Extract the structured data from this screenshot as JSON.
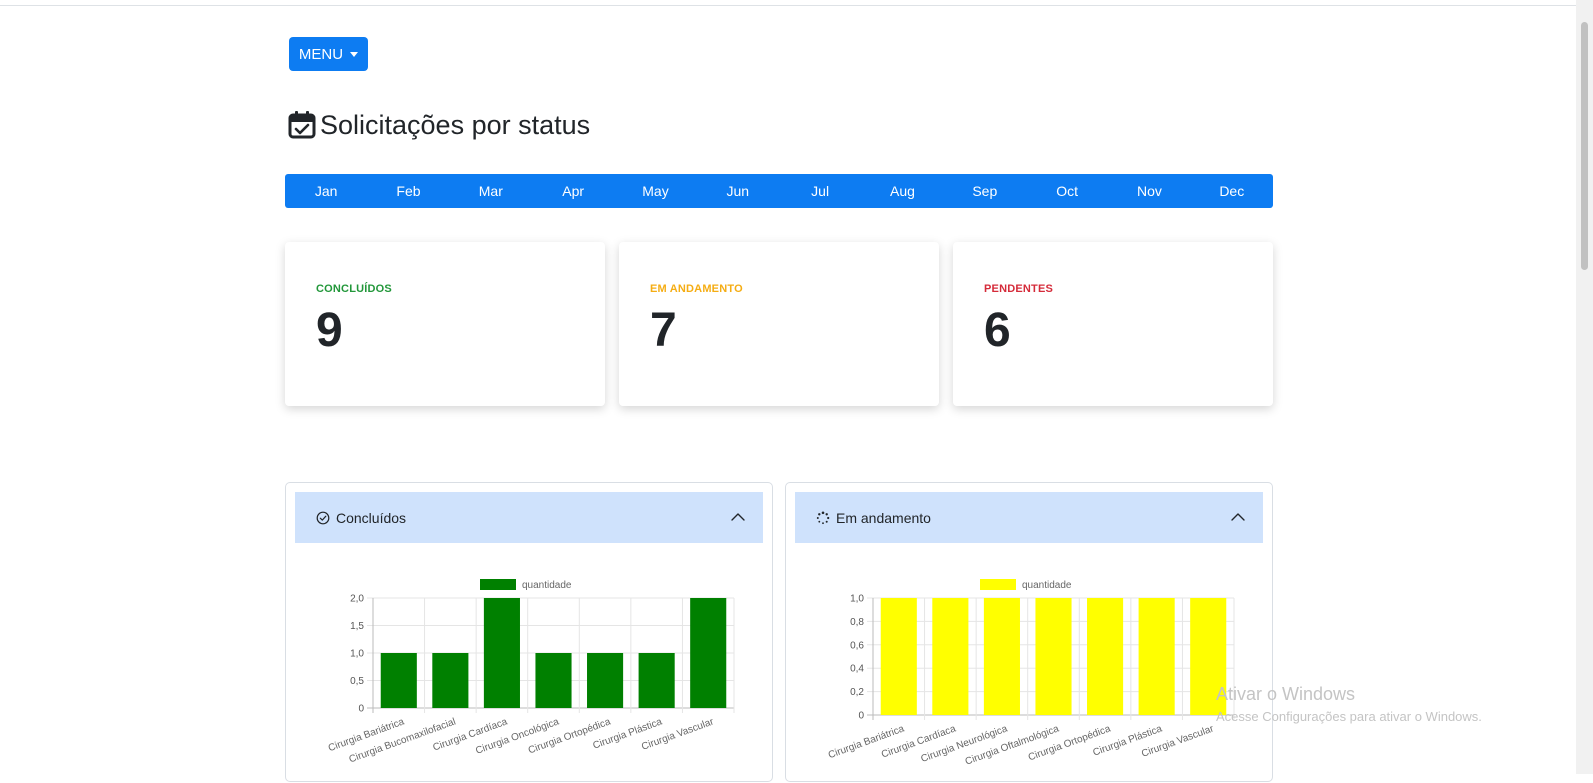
{
  "menu": {
    "label": "MENU"
  },
  "page": {
    "title": "Solicitações por status"
  },
  "months": [
    "Jan",
    "Feb",
    "Mar",
    "Apr",
    "May",
    "Jun",
    "Jul",
    "Aug",
    "Sep",
    "Oct",
    "Nov",
    "Dec"
  ],
  "stats": [
    {
      "label": "CONCLUÍDOS",
      "value": "9",
      "color": "#22973a"
    },
    {
      "label": "EM ANDAMENTO",
      "value": "7",
      "color": "#f5ad14"
    },
    {
      "label": "PENDENTES",
      "value": "6",
      "color": "#d52b3a"
    }
  ],
  "panels": [
    {
      "title": "Concluídos",
      "icon": "check-circle-icon"
    },
    {
      "title": "Em andamento",
      "icon": "spinner-icon"
    }
  ],
  "watermark": {
    "line1": "Ativar o Windows",
    "line2": "Acesse Configurações para ativar o Windows."
  },
  "chart_data": [
    {
      "type": "bar",
      "legend": [
        "quantidade"
      ],
      "categories": [
        "Cirurgia Bariátrica",
        "Cirurgia Bucomaxilofacial",
        "Cirurgia Cardíaca",
        "Cirurgia Oncológica",
        "Cirurgia Ortopédica",
        "Cirurgia Plástica",
        "Cirurgia Vascular"
      ],
      "series": [
        {
          "name": "quantidade",
          "values": [
            1,
            1,
            2,
            1,
            1,
            1,
            2
          ],
          "color": "#008000"
        }
      ],
      "ylim": [
        0,
        2
      ],
      "yticks": [
        "0",
        "0,5",
        "1,0",
        "1,5",
        "2,0"
      ],
      "grid": true,
      "legend_position": "top"
    },
    {
      "type": "bar",
      "legend": [
        "quantidade"
      ],
      "categories": [
        "Cirurgia Bariátrica",
        "Cirurgia Cardíaca",
        "Cirurgia Neurológica",
        "Cirurgia Oftalmológica",
        "Cirurgia Ortopédica",
        "Cirurgia Plástica",
        "Cirurgia Vascular"
      ],
      "series": [
        {
          "name": "quantidade",
          "values": [
            1,
            1,
            1,
            1,
            1,
            1,
            1
          ],
          "color": "#ffff00"
        }
      ],
      "ylim": [
        0,
        1
      ],
      "yticks": [
        "0",
        "0,2",
        "0,4",
        "0,6",
        "0,8",
        "1,0"
      ],
      "grid": true,
      "legend_position": "top"
    }
  ]
}
